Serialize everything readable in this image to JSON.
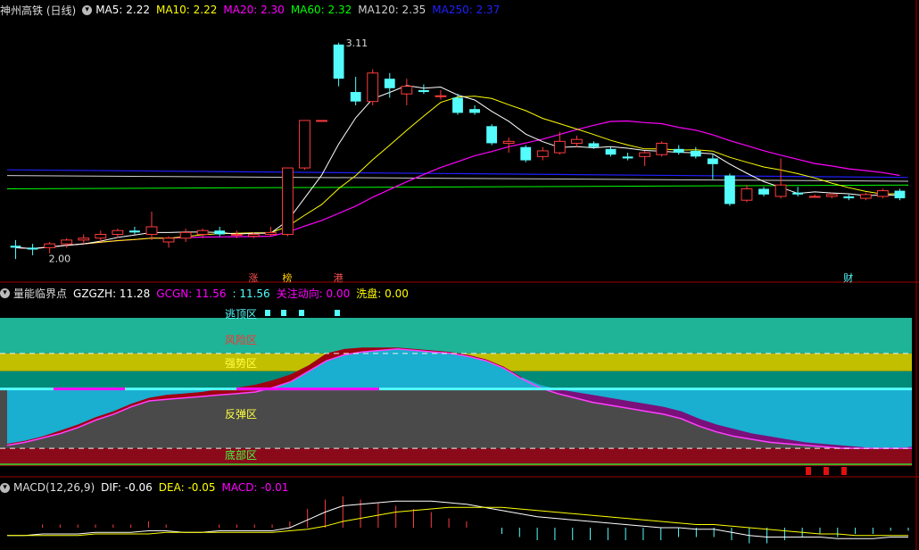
{
  "colors": {
    "bg": "#000000",
    "up": "#ff3c3c",
    "down": "#54fcfc",
    "ma5": "#ffffff",
    "ma10": "#ffff00",
    "ma20": "#ff00ff",
    "ma60": "#00ff00",
    "ma120": "#cfcfcf",
    "ma250": "#2020ff",
    "zone_top": "#1fb397",
    "zone_risk": "#c2be00",
    "zone_strong": "#008a78",
    "zone_rebound": "#4a4a4a",
    "zone_bottom": "#8a0a1a",
    "area_purple": "#7a107a",
    "area_red": "#a00010",
    "area_cyan": "#1aaed0",
    "dif": "#ffffff",
    "dea": "#ffff00"
  },
  "price_panel": {
    "title": "神州高铁 (日线)",
    "toggle_icon": "circle-chevron-icon",
    "ma": [
      {
        "label": "MA5: 2.22",
        "color": "#ffffff"
      },
      {
        "label": "MA10: 2.22",
        "color": "#ffff00"
      },
      {
        "label": "MA20: 2.30",
        "color": "#ff00ff"
      },
      {
        "label": "MA60: 2.32",
        "color": "#00ff00"
      },
      {
        "label": "MA120: 2.35",
        "color": "#cfcfcf"
      },
      {
        "label": "MA250: 2.37",
        "color": "#2020ff"
      }
    ],
    "high_label": "3.11",
    "low_label": "2.00",
    "markers": [
      "涨",
      "榜",
      "港",
      "财"
    ]
  },
  "indicator_panel": {
    "title": "量能临界点",
    "fields": [
      {
        "label": "GZGZH: 11.28",
        "color": "#ffffff"
      },
      {
        "label": "GCGN: 11.56",
        "color": "#ff00ff"
      },
      {
        "label": ": 11.56",
        "color": "#54fcfc"
      },
      {
        "label": "关注动向: 0.00",
        "color": "#ff00ff"
      },
      {
        "label": "洗盘: 0.00",
        "color": "#ffff00"
      }
    ],
    "zones": [
      "逃顶区",
      "风险区",
      "强势区",
      "反弹区",
      "底部区"
    ]
  },
  "macd_panel": {
    "title": "MACD(12,26,9)",
    "fields": [
      {
        "label": "DIF: -0.06",
        "color": "#ffffff"
      },
      {
        "label": "DEA: -0.05",
        "color": "#ffff00"
      },
      {
        "label": "MACD: -0.01",
        "color": "#ff00ff"
      }
    ]
  },
  "chart_data": [
    {
      "type": "candlestick",
      "ylim": [
        1.9,
        3.25
      ],
      "candles": [
        {
          "o": 2.04,
          "h": 2.07,
          "l": 1.97,
          "c": 2.03
        },
        {
          "o": 2.03,
          "h": 2.05,
          "l": 1.99,
          "c": 2.02
        },
        {
          "o": 2.03,
          "h": 2.06,
          "l": 2.0,
          "c": 2.05
        },
        {
          "o": 2.05,
          "h": 2.08,
          "l": 2.03,
          "c": 2.07
        },
        {
          "o": 2.07,
          "h": 2.1,
          "l": 2.05,
          "c": 2.08
        },
        {
          "o": 2.08,
          "h": 2.12,
          "l": 2.06,
          "c": 2.1
        },
        {
          "o": 2.1,
          "h": 2.13,
          "l": 2.08,
          "c": 2.12
        },
        {
          "o": 2.12,
          "h": 2.14,
          "l": 2.1,
          "c": 2.11
        },
        {
          "o": 2.1,
          "h": 2.22,
          "l": 2.07,
          "c": 2.14
        },
        {
          "o": 2.06,
          "h": 2.09,
          "l": 2.03,
          "c": 2.08
        },
        {
          "o": 2.08,
          "h": 2.13,
          "l": 2.06,
          "c": 2.11
        },
        {
          "o": 2.1,
          "h": 2.13,
          "l": 2.08,
          "c": 2.12
        },
        {
          "o": 2.12,
          "h": 2.14,
          "l": 2.09,
          "c": 2.1
        },
        {
          "o": 2.1,
          "h": 2.12,
          "l": 2.08,
          "c": 2.1
        },
        {
          "o": 2.09,
          "h": 2.11,
          "l": 2.08,
          "c": 2.1
        },
        {
          "o": 2.1,
          "h": 2.14,
          "l": 2.09,
          "c": 2.11
        },
        {
          "o": 2.1,
          "h": 2.45,
          "l": 2.09,
          "c": 2.45
        },
        {
          "o": 2.45,
          "h": 2.7,
          "l": 2.44,
          "c": 2.7
        },
        {
          "o": 2.7,
          "h": 2.7,
          "l": 2.7,
          "c": 2.7
        },
        {
          "o": 3.1,
          "h": 3.11,
          "l": 2.88,
          "c": 2.92
        },
        {
          "o": 2.85,
          "h": 2.93,
          "l": 2.78,
          "c": 2.8
        },
        {
          "o": 2.8,
          "h": 2.97,
          "l": 2.78,
          "c": 2.95
        },
        {
          "o": 2.92,
          "h": 2.95,
          "l": 2.82,
          "c": 2.87
        },
        {
          "o": 2.84,
          "h": 2.92,
          "l": 2.78,
          "c": 2.88
        },
        {
          "o": 2.86,
          "h": 2.89,
          "l": 2.84,
          "c": 2.85
        },
        {
          "o": 2.83,
          "h": 2.86,
          "l": 2.81,
          "c": 2.83
        },
        {
          "o": 2.82,
          "h": 2.84,
          "l": 2.73,
          "c": 2.74
        },
        {
          "o": 2.76,
          "h": 2.78,
          "l": 2.73,
          "c": 2.74
        },
        {
          "o": 2.67,
          "h": 2.68,
          "l": 2.57,
          "c": 2.58
        },
        {
          "o": 2.58,
          "h": 2.61,
          "l": 2.53,
          "c": 2.59
        },
        {
          "o": 2.56,
          "h": 2.57,
          "l": 2.48,
          "c": 2.49
        },
        {
          "o": 2.51,
          "h": 2.56,
          "l": 2.49,
          "c": 2.54
        },
        {
          "o": 2.53,
          "h": 2.64,
          "l": 2.52,
          "c": 2.59
        },
        {
          "o": 2.58,
          "h": 2.62,
          "l": 2.56,
          "c": 2.6
        },
        {
          "o": 2.58,
          "h": 2.59,
          "l": 2.55,
          "c": 2.56
        },
        {
          "o": 2.55,
          "h": 2.56,
          "l": 2.51,
          "c": 2.52
        },
        {
          "o": 2.51,
          "h": 2.53,
          "l": 2.49,
          "c": 2.5
        },
        {
          "o": 2.51,
          "h": 2.54,
          "l": 2.46,
          "c": 2.53
        },
        {
          "o": 2.52,
          "h": 2.59,
          "l": 2.51,
          "c": 2.58
        },
        {
          "o": 2.55,
          "h": 2.57,
          "l": 2.52,
          "c": 2.53
        },
        {
          "o": 2.54,
          "h": 2.56,
          "l": 2.5,
          "c": 2.51
        },
        {
          "o": 2.5,
          "h": 2.52,
          "l": 2.39,
          "c": 2.47
        },
        {
          "o": 2.41,
          "h": 2.42,
          "l": 2.25,
          "c": 2.26
        },
        {
          "o": 2.28,
          "h": 2.36,
          "l": 2.27,
          "c": 2.34
        },
        {
          "o": 2.34,
          "h": 2.35,
          "l": 2.3,
          "c": 2.31
        },
        {
          "o": 2.3,
          "h": 2.5,
          "l": 2.29,
          "c": 2.36
        },
        {
          "o": 2.32,
          "h": 2.35,
          "l": 2.3,
          "c": 2.31
        },
        {
          "o": 2.3,
          "h": 2.31,
          "l": 2.3,
          "c": 2.3
        },
        {
          "o": 2.3,
          "h": 2.32,
          "l": 2.29,
          "c": 2.31
        },
        {
          "o": 2.3,
          "h": 2.31,
          "l": 2.28,
          "c": 2.29
        },
        {
          "o": 2.29,
          "h": 2.32,
          "l": 2.28,
          "c": 2.31
        },
        {
          "o": 2.3,
          "h": 2.34,
          "l": 2.29,
          "c": 2.33
        },
        {
          "o": 2.33,
          "h": 2.34,
          "l": 2.28,
          "c": 2.29
        }
      ]
    },
    {
      "type": "area",
      "ylim": [
        0,
        100
      ],
      "bands": [
        88,
        76,
        64,
        52,
        12,
        7
      ],
      "series": [
        {
          "values": [
            15,
            17,
            20,
            24,
            28,
            33,
            37,
            42,
            46,
            48,
            49,
            50,
            52,
            53,
            55,
            58,
            62,
            68,
            76,
            79,
            80,
            80,
            80,
            79,
            78,
            77,
            75,
            72,
            67,
            60,
            55,
            52,
            50,
            48,
            46,
            44,
            42,
            40,
            37,
            32,
            28,
            25,
            22,
            20,
            18,
            16,
            15,
            14,
            13,
            12,
            12,
            13
          ]
        },
        {
          "values": [
            14,
            16,
            19,
            22,
            26,
            31,
            35,
            40,
            44,
            45,
            46,
            47,
            48,
            49,
            50,
            53,
            57,
            64,
            71,
            75,
            77,
            78,
            79,
            78,
            77,
            76,
            74,
            71,
            66,
            59,
            53,
            49,
            46,
            43,
            41,
            39,
            37,
            35,
            32,
            27,
            23,
            20,
            18,
            16,
            15,
            14,
            13,
            12,
            12,
            12,
            12,
            12
          ]
        },
        {
          "values": [
            0,
            0,
            0,
            0,
            0,
            0,
            0,
            0,
            0,
            0,
            0,
            0,
            0,
            0,
            0,
            0,
            0,
            0,
            0,
            0,
            0,
            0,
            0,
            0,
            0,
            0,
            0,
            0,
            0,
            0,
            0,
            0,
            0,
            0,
            0,
            0,
            0,
            0,
            0,
            0,
            0,
            0,
            0,
            0,
            0,
            0,
            0,
            0,
            5,
            5,
            5,
            0
          ]
        }
      ]
    },
    {
      "type": "line",
      "ylim": [
        -0.12,
        0.2
      ],
      "series": [
        {
          "name": "DIF",
          "values": [
            -0.05,
            -0.05,
            -0.04,
            -0.04,
            -0.04,
            -0.03,
            -0.03,
            -0.03,
            -0.02,
            -0.02,
            -0.03,
            -0.03,
            -0.02,
            -0.02,
            -0.02,
            -0.02,
            0.0,
            0.05,
            0.1,
            0.14,
            0.15,
            0.16,
            0.17,
            0.17,
            0.17,
            0.16,
            0.15,
            0.13,
            0.11,
            0.09,
            0.07,
            0.06,
            0.05,
            0.04,
            0.03,
            0.02,
            0.01,
            0.0,
            0.0,
            -0.01,
            -0.01,
            -0.03,
            -0.05,
            -0.06,
            -0.06,
            -0.06,
            -0.06,
            -0.07,
            -0.07,
            -0.07,
            -0.06,
            -0.06
          ]
        },
        {
          "name": "DEA",
          "values": [
            -0.05,
            -0.05,
            -0.05,
            -0.05,
            -0.05,
            -0.04,
            -0.04,
            -0.04,
            -0.04,
            -0.03,
            -0.03,
            -0.03,
            -0.03,
            -0.03,
            -0.03,
            -0.03,
            -0.02,
            -0.01,
            0.01,
            0.04,
            0.06,
            0.08,
            0.1,
            0.11,
            0.12,
            0.13,
            0.13,
            0.13,
            0.13,
            0.12,
            0.11,
            0.1,
            0.09,
            0.08,
            0.07,
            0.06,
            0.05,
            0.04,
            0.03,
            0.02,
            0.02,
            0.01,
            0.0,
            -0.01,
            -0.02,
            -0.03,
            -0.04,
            -0.04,
            -0.05,
            -0.05,
            -0.05,
            -0.05
          ]
        }
      ]
    }
  ]
}
